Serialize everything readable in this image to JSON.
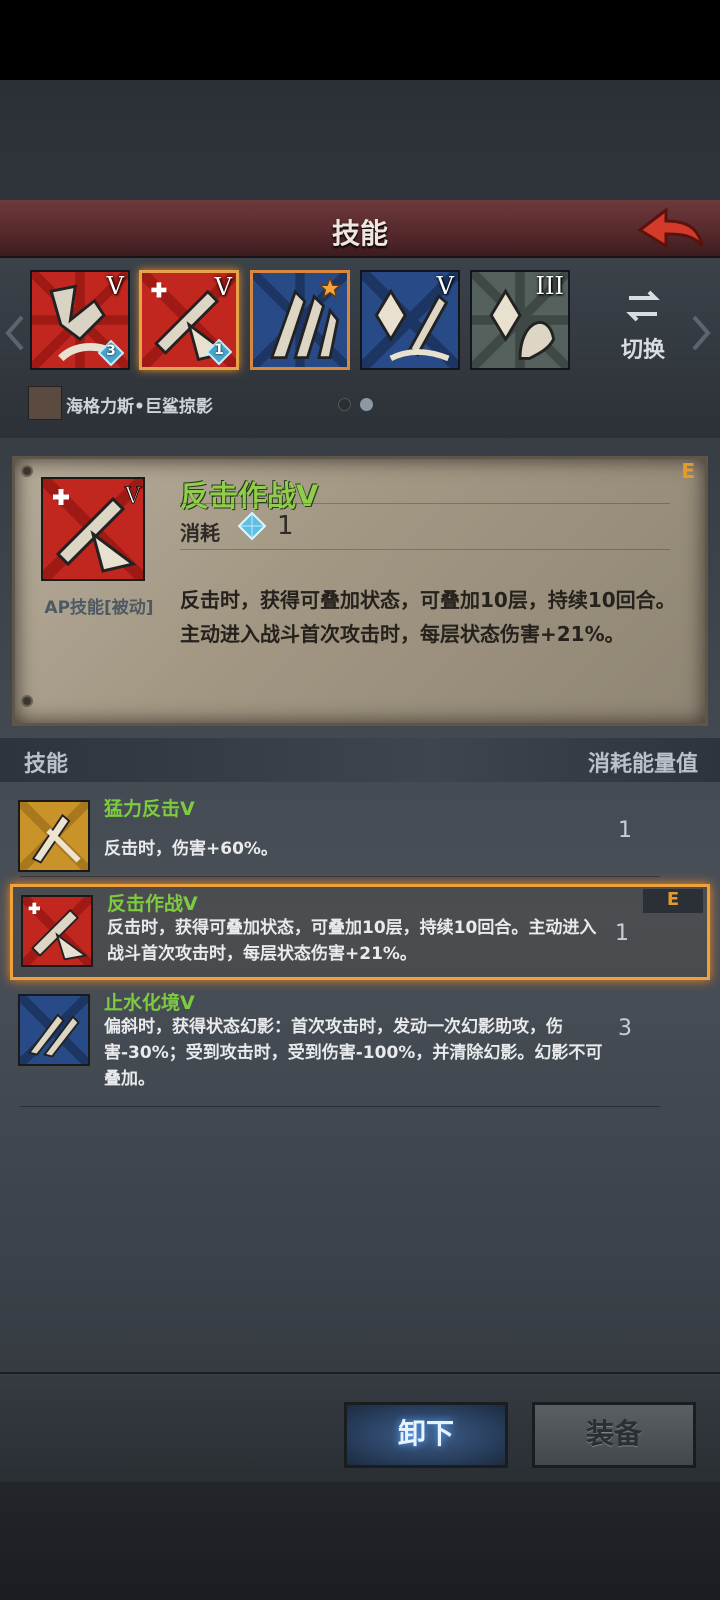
{
  "header": {
    "title": "技能"
  },
  "strip": {
    "slots": [
      {
        "tier": "V",
        "badge": "3"
      },
      {
        "tier": "V",
        "badge": "1"
      },
      {
        "tier": "",
        "badge": ""
      },
      {
        "tier": "V",
        "badge": ""
      },
      {
        "tier": "III",
        "badge": ""
      }
    ],
    "switch_label": "切换",
    "hero_name": "海格力斯•巨鲨掠影"
  },
  "detail": {
    "title": "反击作战V",
    "cost_label": "消耗",
    "cost_value": "1",
    "type": "AP技能[被动]",
    "grade": "E",
    "description": "反击时，获得可叠加状态，可叠加10层，持续10回合。主动进入战斗首次攻击时，每层状态伤害+21%。"
  },
  "list": {
    "header_left": "技能",
    "header_right": "消耗能量值",
    "rows": [
      {
        "title": "猛力反击V",
        "desc": "反击时，伤害+60%。",
        "value": "1",
        "grade": ""
      },
      {
        "title": "反击作战V",
        "desc": "反击时，获得可叠加状态，可叠加10层，持续10回合。主动进入战斗首次攻击时，每层状态伤害+21%。",
        "value": "1",
        "grade": "E"
      },
      {
        "title": "止水化境V",
        "desc": "偏斜时，获得状态幻影：首次攻击时，发动一次幻影助攻，伤害-30%；受到攻击时，受到伤害-100%，并清除幻影。幻影不可叠加。",
        "value": "3",
        "grade": ""
      }
    ]
  },
  "buttons": {
    "unequip": "卸下",
    "equip": "装备"
  },
  "colors": {
    "accent_orange": "#f0a23a",
    "skill_green": "#7ecb3f",
    "header_red": "#55282b"
  }
}
